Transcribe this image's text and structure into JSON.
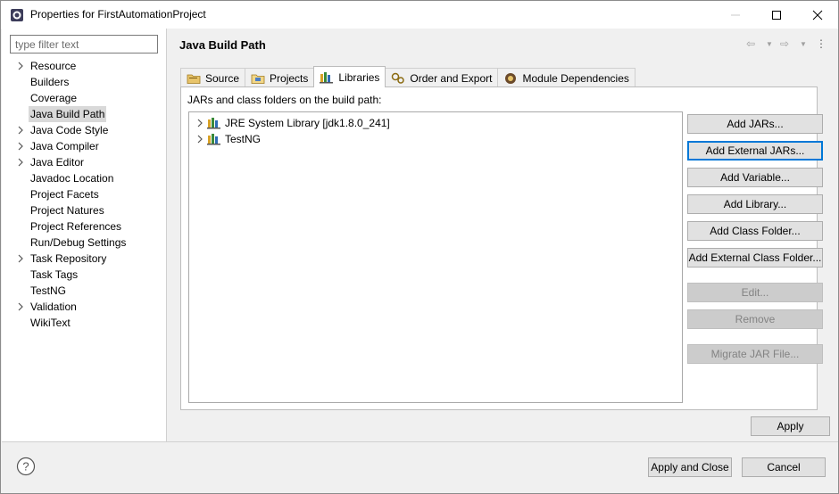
{
  "window": {
    "title": "Properties for FirstAutomationProject"
  },
  "filter": {
    "placeholder": "type filter text"
  },
  "sidebar": {
    "items": [
      {
        "label": "Resource",
        "expandable": true
      },
      {
        "label": "Builders",
        "expandable": false
      },
      {
        "label": "Coverage",
        "expandable": false
      },
      {
        "label": "Java Build Path",
        "expandable": false,
        "selected": true
      },
      {
        "label": "Java Code Style",
        "expandable": true
      },
      {
        "label": "Java Compiler",
        "expandable": true
      },
      {
        "label": "Java Editor",
        "expandable": true
      },
      {
        "label": "Javadoc Location",
        "expandable": false
      },
      {
        "label": "Project Facets",
        "expandable": false
      },
      {
        "label": "Project Natures",
        "expandable": false
      },
      {
        "label": "Project References",
        "expandable": false
      },
      {
        "label": "Run/Debug Settings",
        "expandable": false
      },
      {
        "label": "Task Repository",
        "expandable": true
      },
      {
        "label": "Task Tags",
        "expandable": false
      },
      {
        "label": "TestNG",
        "expandable": false
      },
      {
        "label": "Validation",
        "expandable": true
      },
      {
        "label": "WikiText",
        "expandable": false
      }
    ]
  },
  "page": {
    "title": "Java Build Path"
  },
  "tabs": [
    {
      "label": "Source",
      "icon": "source-folder-icon"
    },
    {
      "label": "Projects",
      "icon": "projects-folder-icon"
    },
    {
      "label": "Libraries",
      "icon": "libraries-icon",
      "active": true
    },
    {
      "label": "Order and Export",
      "icon": "order-export-icon"
    },
    {
      "label": "Module Dependencies",
      "icon": "module-dependencies-icon"
    }
  ],
  "libraries": {
    "caption": "JARs and class folders on the build path:",
    "entries": [
      {
        "label": "JRE System Library [jdk1.8.0_241]"
      },
      {
        "label": "TestNG"
      }
    ]
  },
  "buttons": {
    "add_jars": "Add JARs...",
    "add_external_jars": "Add External JARs...",
    "add_variable": "Add Variable...",
    "add_library": "Add Library...",
    "add_class_folder": "Add Class Folder...",
    "add_external_class_folder": "Add External Class Folder...",
    "edit": "Edit...",
    "remove": "Remove",
    "migrate_jar": "Migrate JAR File...",
    "apply": "Apply",
    "apply_and_close": "Apply and Close",
    "cancel": "Cancel"
  },
  "colors": {
    "focus_border": "#0078d7",
    "selection": "#d9d9d9",
    "disabled_text": "#838383"
  }
}
